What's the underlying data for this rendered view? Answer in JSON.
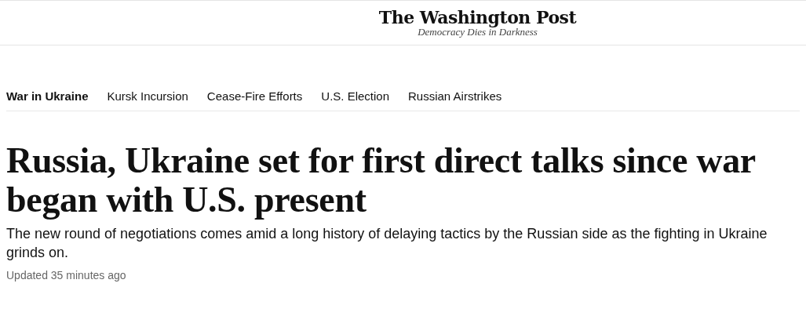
{
  "masthead": {
    "logo": "The Washington Post",
    "tagline": "Democracy Dies in Darkness"
  },
  "nav": [
    {
      "label": "War in Ukraine",
      "kind": "section"
    },
    {
      "label": "Kursk Incursion",
      "kind": "topic"
    },
    {
      "label": "Cease-Fire Efforts",
      "kind": "topic"
    },
    {
      "label": "U.S. Election",
      "kind": "topic"
    },
    {
      "label": "Russian Airstrikes",
      "kind": "topic"
    }
  ],
  "article": {
    "headline": "Russia, Ukraine set for first direct talks since war began with U.S. present",
    "subheadline": "The new round of negotiations comes amid a long history of delaying tactics by the Russian side as the fighting in Ukraine grinds on.",
    "timestamp": "Updated 35 minutes ago"
  }
}
